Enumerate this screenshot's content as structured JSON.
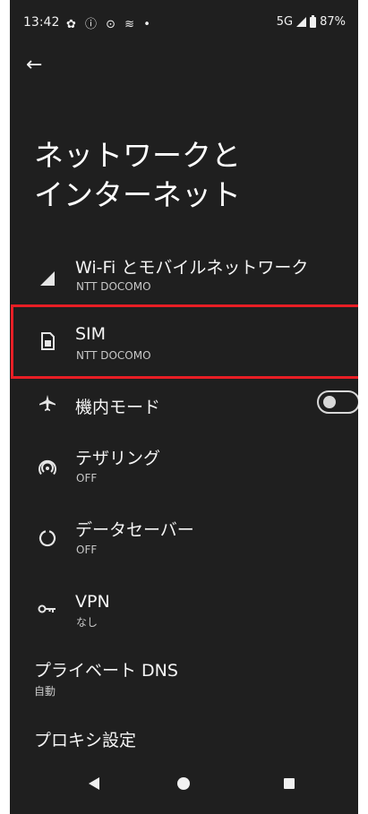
{
  "status_bar": {
    "time": "13:42",
    "icons": "✿ ⓘ ⊙ ≋ •",
    "network": "5G",
    "battery": "87%"
  },
  "page": {
    "title_line1": "ネットワークと",
    "title_line2": "インターネット"
  },
  "items": [
    {
      "icon": "signal-icon",
      "label": "Wi-Fi とモバイルネットワーク",
      "sub": "NTT DOCOMO"
    },
    {
      "icon": "sim-card-icon",
      "label": "SIM",
      "sub": "NTT DOCOMO"
    },
    {
      "icon": "airplane-icon",
      "label": "機内モード",
      "toggle": "off"
    },
    {
      "icon": "hotspot-icon",
      "label": "テザリング",
      "sub": "OFF"
    },
    {
      "icon": "data-saver-icon",
      "label": "データセーバー",
      "sub": "OFF"
    },
    {
      "icon": "vpn-key-icon",
      "label": "VPN",
      "sub": "なし"
    },
    {
      "label": "プライベート DNS",
      "sub": "自動"
    },
    {
      "label": "プロキシ設定"
    }
  ],
  "colors": {
    "background": "#1f1f1f",
    "highlight": "#e81e25"
  }
}
